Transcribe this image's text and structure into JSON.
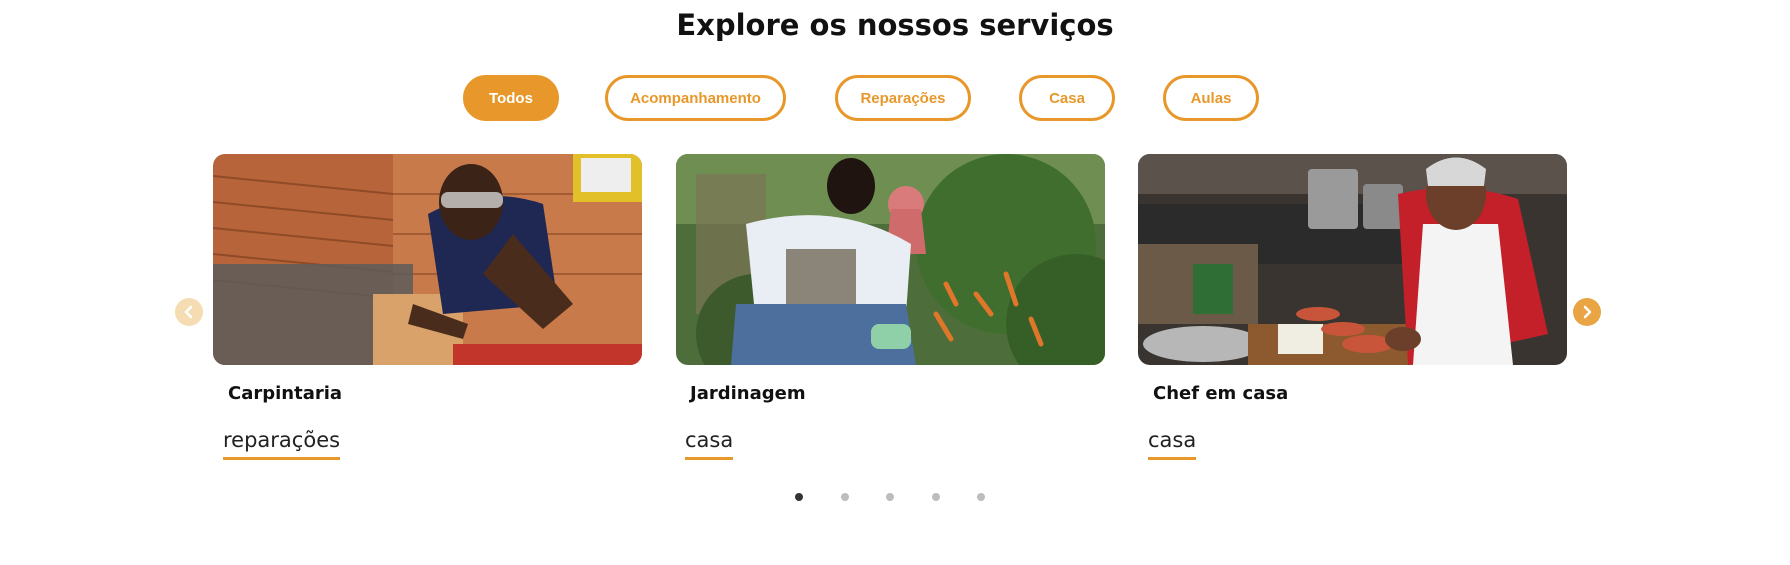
{
  "section": {
    "title": "Explore os nossos serviços"
  },
  "filters": [
    {
      "label": "Todos",
      "active": true
    },
    {
      "label": "Acompanhamento",
      "active": false
    },
    {
      "label": "Reparações",
      "active": false
    },
    {
      "label": "Casa",
      "active": false
    },
    {
      "label": "Aulas",
      "active": false
    }
  ],
  "cards": [
    {
      "title": "Carpintaria",
      "tag": "reparações",
      "image": "man-sanding-wood-in-workshop"
    },
    {
      "title": "Jardinagem",
      "tag": "casa",
      "image": "woman-gardening-peppers"
    },
    {
      "title": "Chef em casa",
      "tag": "casa",
      "image": "elderly-woman-cooking-in-kitchen"
    }
  ],
  "carousel": {
    "prev_icon": "chevron-left-icon",
    "next_icon": "chevron-right-icon",
    "pages": 5,
    "current_page": 1
  },
  "colors": {
    "accent": "#e8982b",
    "text": "#111111",
    "dot_inactive": "#bdbdbd",
    "dot_active": "#333333"
  }
}
